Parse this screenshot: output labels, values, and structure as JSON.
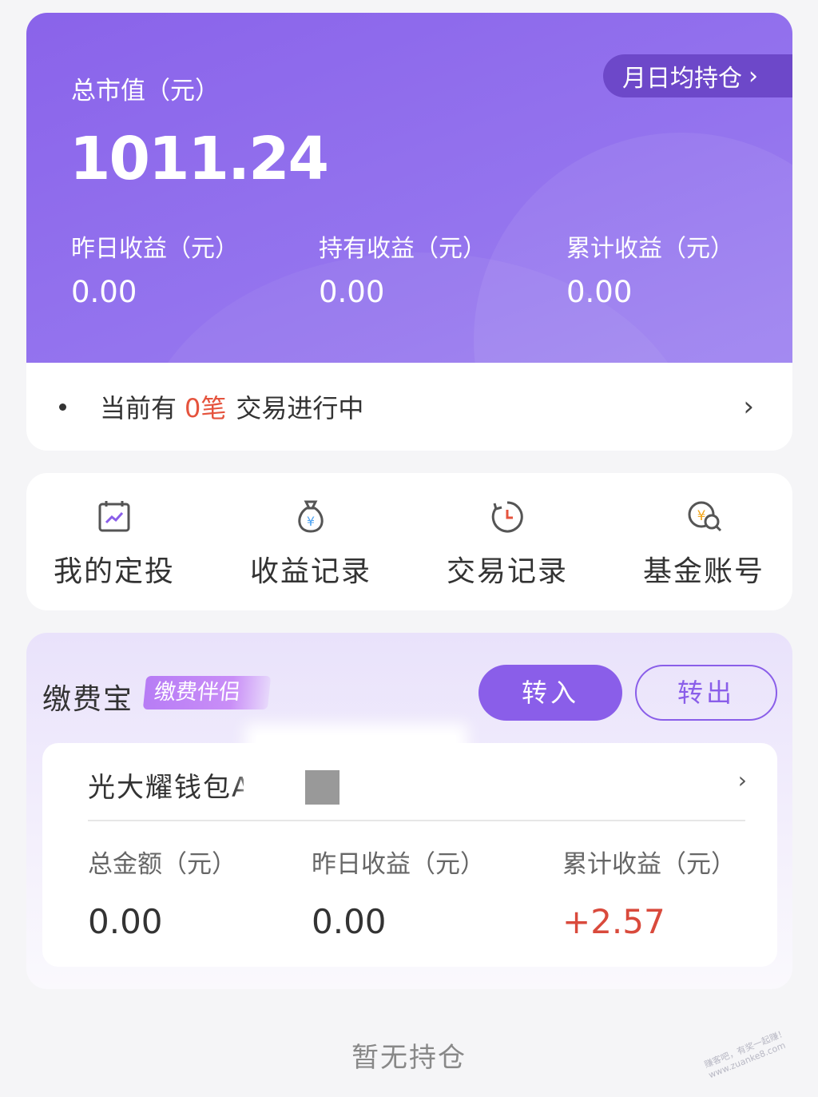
{
  "asset": {
    "total_label": "总市值（元）",
    "total_value": "1011.24",
    "monthly_label": "月日均持仓",
    "metrics": [
      {
        "label": "昨日收益（元）",
        "value": "0.00"
      },
      {
        "label": "持有收益（元）",
        "value": "0.00"
      },
      {
        "label": "累计收益（元）",
        "value": "0.00"
      }
    ],
    "trade": {
      "prefix": "当前有",
      "count": "0笔",
      "suffix": "交易进行中"
    }
  },
  "quick_entries": [
    {
      "label": "我的定投",
      "icon": "calendar-chart-icon"
    },
    {
      "label": "收益记录",
      "icon": "money-bag-icon"
    },
    {
      "label": "交易记录",
      "icon": "clock-history-icon"
    },
    {
      "label": "基金账号",
      "icon": "yen-search-icon"
    }
  ],
  "pay": {
    "title": "缴费宝",
    "tag": "缴费伴侣",
    "btn_in": "转入",
    "btn_out": "转出",
    "wallet": {
      "name": "光大耀钱包A",
      "metrics": [
        {
          "label": "总金额（元）",
          "value": "0.00"
        },
        {
          "label": "昨日收益（元）",
          "value": "0.00"
        },
        {
          "label": "累计收益（元）",
          "value": "+2.57"
        }
      ]
    }
  },
  "empty_text": "暂无持仓",
  "watermark": "赚客吧，有奖一起赚！ www.zuanke8.com",
  "colors": {
    "primary": "#8a5ee9",
    "negative_red": "#e5533d",
    "positive_red": "#d94a3c"
  }
}
